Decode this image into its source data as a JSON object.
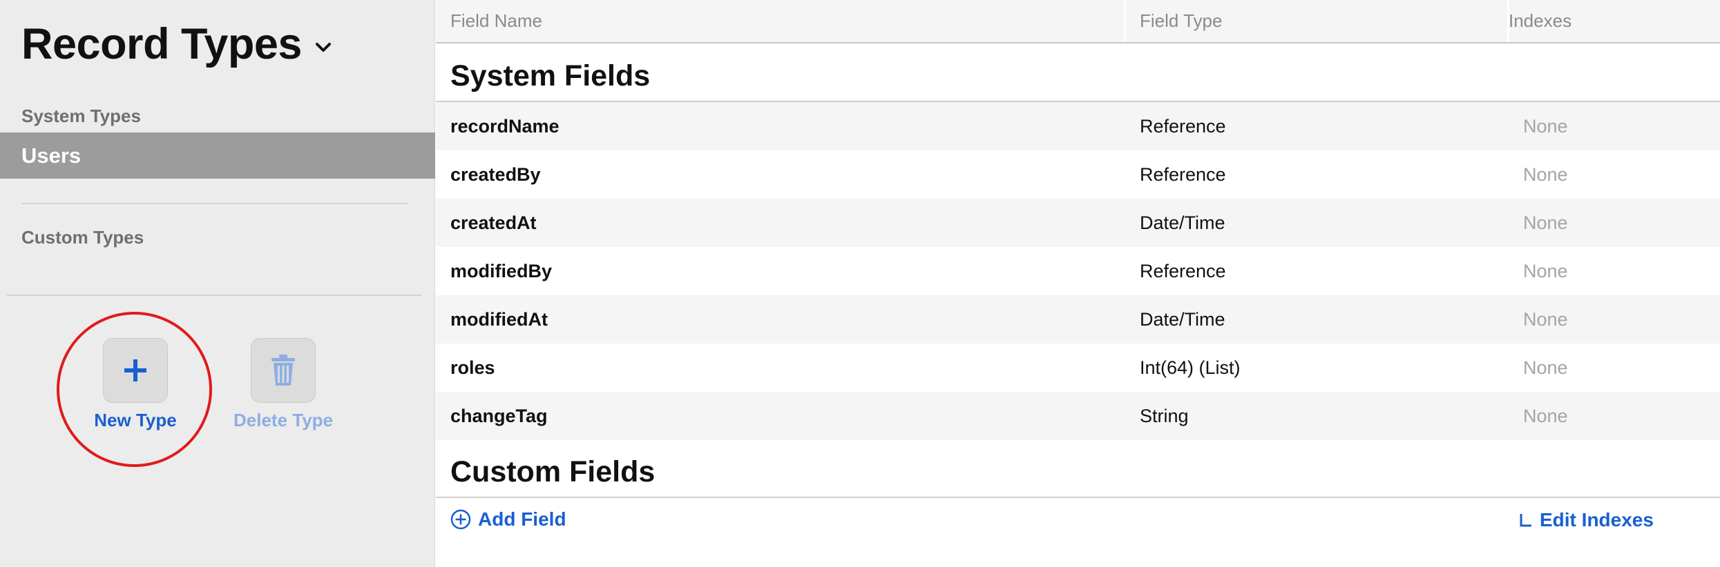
{
  "sidebar": {
    "title": "Record Types",
    "system_types_label": "System Types",
    "items": [
      {
        "label": "Users",
        "selected": true
      }
    ],
    "custom_types_label": "Custom Types",
    "new_type_label": "New Type",
    "delete_type_label": "Delete Type"
  },
  "table": {
    "columns": [
      "Field Name",
      "Field Type",
      "Indexes"
    ],
    "system_fields_heading": "System Fields",
    "custom_fields_heading": "Custom Fields",
    "system_fields": [
      {
        "name": "recordName",
        "type": "Reference",
        "indexes": "None"
      },
      {
        "name": "createdBy",
        "type": "Reference",
        "indexes": "None"
      },
      {
        "name": "createdAt",
        "type": "Date/Time",
        "indexes": "None"
      },
      {
        "name": "modifiedBy",
        "type": "Reference",
        "indexes": "None"
      },
      {
        "name": "modifiedAt",
        "type": "Date/Time",
        "indexes": "None"
      },
      {
        "name": "roles",
        "type": "Int(64) (List)",
        "indexes": "None"
      },
      {
        "name": "changeTag",
        "type": "String",
        "indexes": "None"
      }
    ],
    "add_field_label": "Add Field",
    "edit_indexes_label": "Edit Indexes"
  },
  "colors": {
    "accent": "#1a5fd0",
    "highlight_ring": "#e01b1b",
    "selected_item": "#9c9c9c"
  }
}
